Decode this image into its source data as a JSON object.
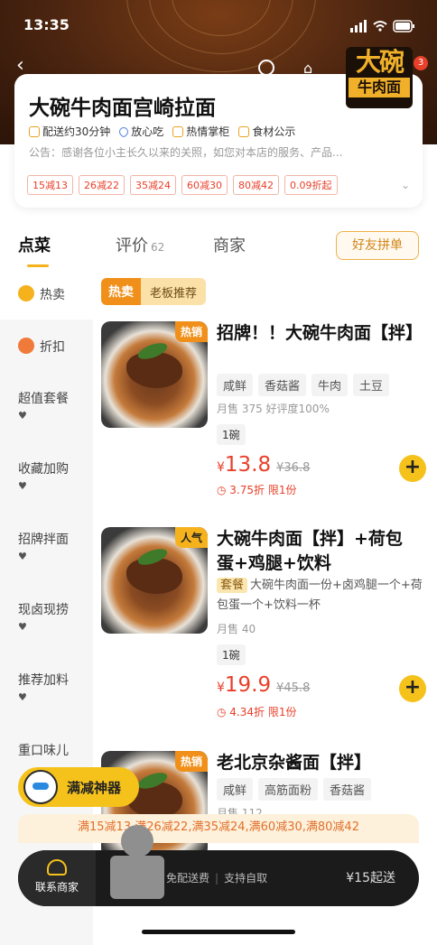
{
  "status_bar": {
    "time": "13:35"
  },
  "store": {
    "name": "大碗牛肉面宫崎拉面",
    "tags": [
      "配送约30分钟",
      "放心吃",
      "热情掌柜",
      "食材公示"
    ],
    "notice": "公告：感谢各位小主长久以来的关照，如您对本店的服务、产品...",
    "logo_line1": "大碗",
    "logo_line2": "牛肉面",
    "logo_badge": "3",
    "discounts": [
      "15减13",
      "26减22",
      "35减24",
      "60减30",
      "80减42",
      "0.09折起"
    ]
  },
  "tabs": [
    {
      "label": "点菜"
    },
    {
      "label": "评价",
      "count": "62"
    },
    {
      "label": "商家"
    }
  ],
  "friend_button": "好友拼单",
  "sidebar": {
    "items": [
      {
        "label": "热卖"
      },
      {
        "label": "折扣"
      },
      {
        "label": "超值套餐"
      },
      {
        "label": "收藏加购"
      },
      {
        "label": "招牌拌面"
      },
      {
        "label": "现卤现捞"
      },
      {
        "label": "推荐加料"
      },
      {
        "label": "重口味儿"
      }
    ]
  },
  "section": {
    "hot": "热卖",
    "boss": "老板推荐"
  },
  "dishes": [
    {
      "badge": "热销",
      "title": "招牌！！大碗牛肉面【拌】",
      "chips": [
        "咸鲜",
        "香菇酱",
        "牛肉",
        "土豆"
      ],
      "meta": "月售 375  好评度100%",
      "unit": "1碗",
      "price": "13.8",
      "orig": "¥36.8",
      "promo": "3.75折 限1份"
    },
    {
      "badge": "人气",
      "title": "大碗牛肉面【拌】+荷包蛋+鸡腿+饮料",
      "combo_tag": "套餐",
      "combo": "大碗牛肉面一份+卤鸡腿一个+荷包蛋一个+饮料一杯",
      "meta": "月售 40",
      "unit": "1碗",
      "price": "19.9",
      "orig": "¥45.8",
      "promo": "4.34折 限1份"
    },
    {
      "badge": "热销",
      "title": "老北京杂酱面【拌】",
      "chips": [
        "咸鲜",
        "高筋面粉",
        "香菇酱"
      ],
      "meta": "月售 112"
    }
  ],
  "manjian": "满减神器",
  "full_reduce_text": "满15减13,满26减22,满35减24,满60减30,满80减42",
  "cart": {
    "contact": "联系商家",
    "info1": "免配送费",
    "info2": "支持自取",
    "go": "¥15起送"
  },
  "colors": {
    "accent": "#f5c21c",
    "price": "#e8402a",
    "banner": "#4a2410"
  }
}
